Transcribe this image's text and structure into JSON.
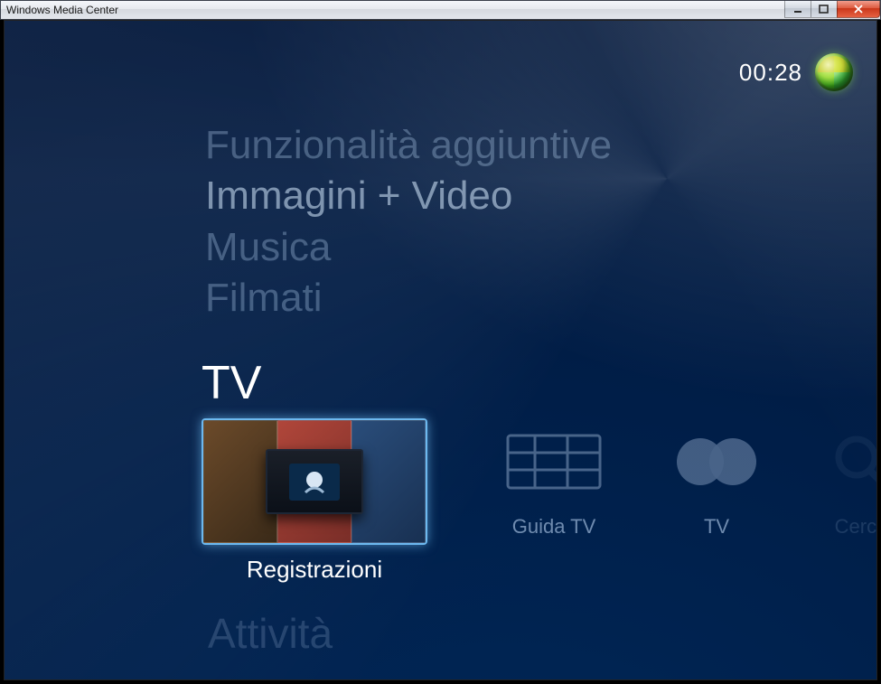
{
  "window": {
    "title": "Windows Media Center"
  },
  "clock": "00:28",
  "categories": {
    "above": [
      {
        "label": "Funzionalità aggiuntive"
      },
      {
        "label": "Immagini + Video"
      },
      {
        "label": "Musica"
      },
      {
        "label": "Filmati"
      }
    ],
    "active": "TV",
    "below": "Attività"
  },
  "tiles": [
    {
      "label": "Registrazioni",
      "icon": "recordings-icon",
      "selected": true
    },
    {
      "label": "Guida TV",
      "icon": "guide-icon"
    },
    {
      "label": "TV",
      "icon": "tv-icon"
    },
    {
      "label": "Cerca",
      "icon": "search-icon"
    }
  ]
}
